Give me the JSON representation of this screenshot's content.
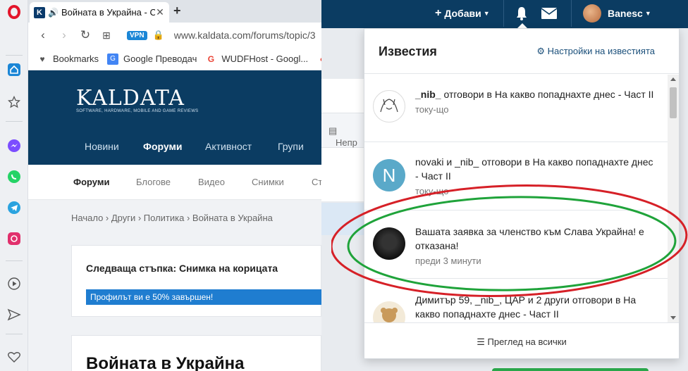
{
  "browser": {
    "tab_title": "Войната в Украйна - С",
    "url": "www.kaldata.com/forums/topic/3",
    "vpn_label": "VPN",
    "favicon_letter": "K",
    "bookmarks": [
      "Bookmarks",
      "Google Преводач",
      "WUDFHost - Googl..."
    ]
  },
  "site": {
    "logo": "KALDATA",
    "tagline": "SOFTWARE, HARDWARE, MOBILE AND GAME REVIEWS",
    "nav": [
      "Новини",
      "Форуми",
      "Активност",
      "Групи"
    ],
    "subnav": [
      "Форуми",
      "Блогове",
      "Видео",
      "Снимки",
      "Ст"
    ],
    "breadcrumb": "Начало  ›  Други  ›  Политика  ›  Войната в Украйна",
    "next_step": "Следваща стъпка: Снимка на корицата",
    "profile_progress_label": "Профилът ви е 50% завършен!",
    "profile_progress": 0.5,
    "topic_title": "Войната в Украйна",
    "partial_label": "Непр"
  },
  "header": {
    "add_label": "Добави",
    "username": "Banesc"
  },
  "notifications": {
    "title": "Известия",
    "settings_label": "Настройки на известията",
    "view_all_label": "Преглед на всички",
    "items": [
      {
        "actors": "_nib_",
        "text": " отговори в На какво попаднахте днес - Част II",
        "time": "току-що"
      },
      {
        "actors": "novaki и _nib_",
        "text": " отговори в На какво попаднахте днес - Част II",
        "time": "току-що"
      },
      {
        "actors": "",
        "text": "Вашата заявка за членство към Слава Украйна! е отказана!",
        "time": "преди 3 минути"
      },
      {
        "actors": "Димитър 59, _nib_, ЦАР и 2 други",
        "text": " отговори в На какво попаднахте днес - Част II",
        "time": ""
      }
    ]
  },
  "colors": {
    "brand_blue": "#0b3c62",
    "accent_blue": "#1f7dd0",
    "opera_red": "#e3152b",
    "highlight_red": "#d62027",
    "highlight_green": "#1fa33a"
  }
}
